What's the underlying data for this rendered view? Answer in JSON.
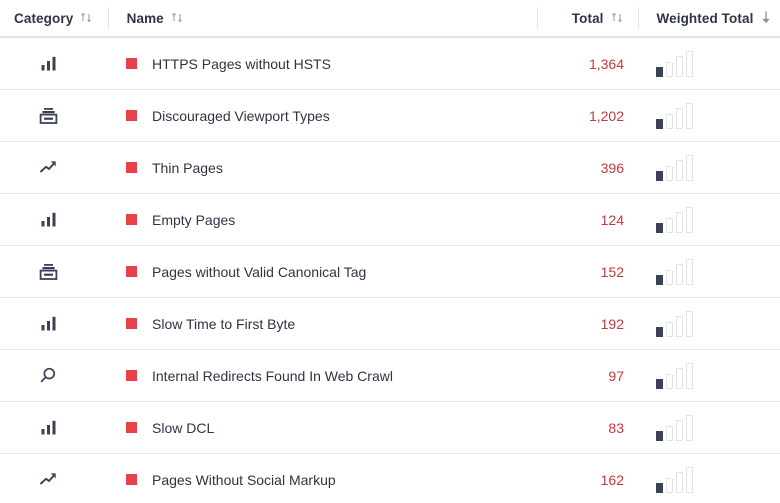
{
  "table": {
    "columns": [
      {
        "key": "category",
        "label": "Category",
        "sort_icon": "sort-updown-icon",
        "sorted": false
      },
      {
        "key": "name",
        "label": "Name",
        "sort_icon": "sort-updown-icon",
        "sorted": false
      },
      {
        "key": "total",
        "label": "Total",
        "sort_icon": "sort-updown-icon",
        "sorted": false
      },
      {
        "key": "weighted_total",
        "label": "Weighted Total",
        "sort_icon": "sort-desc-icon",
        "sorted": true
      }
    ],
    "rows": [
      {
        "category_icon": "bar-chart-icon",
        "marker": "red-square-marker",
        "name": "HTTPS Pages without HSTS",
        "total": "1,364",
        "weighted_chart": {
          "type": "bar",
          "values": [
            8,
            14,
            20,
            25
          ],
          "highlight_index": 0
        }
      },
      {
        "category_icon": "server-stack-icon",
        "marker": "red-square-marker",
        "name": "Discouraged Viewport Types",
        "total": "1,202",
        "weighted_chart": {
          "type": "bar",
          "values": [
            8,
            14,
            20,
            25
          ],
          "highlight_index": 0
        }
      },
      {
        "category_icon": "trending-up-icon",
        "marker": "red-square-marker",
        "name": "Thin Pages",
        "total": "396",
        "weighted_chart": {
          "type": "bar",
          "values": [
            8,
            14,
            20,
            25
          ],
          "highlight_index": 0
        }
      },
      {
        "category_icon": "bar-chart-icon",
        "marker": "red-square-marker",
        "name": "Empty Pages",
        "total": "124",
        "weighted_chart": {
          "type": "bar",
          "values": [
            8,
            14,
            20,
            25
          ],
          "highlight_index": 0
        }
      },
      {
        "category_icon": "server-stack-icon",
        "marker": "red-square-marker",
        "name": "Pages without Valid Canonical Tag",
        "total": "152",
        "weighted_chart": {
          "type": "bar",
          "values": [
            8,
            14,
            20,
            25
          ],
          "highlight_index": 0
        }
      },
      {
        "category_icon": "bar-chart-icon",
        "marker": "red-square-marker",
        "name": "Slow Time to First Byte",
        "total": "192",
        "weighted_chart": {
          "type": "bar",
          "values": [
            8,
            14,
            20,
            25
          ],
          "highlight_index": 0
        }
      },
      {
        "category_icon": "search-icon",
        "marker": "red-square-marker",
        "name": "Internal Redirects Found In Web Crawl",
        "total": "97",
        "weighted_chart": {
          "type": "bar",
          "values": [
            8,
            14,
            20,
            25
          ],
          "highlight_index": 0
        }
      },
      {
        "category_icon": "bar-chart-icon",
        "marker": "red-square-marker",
        "name": "Slow DCL",
        "total": "83",
        "weighted_chart": {
          "type": "bar",
          "values": [
            8,
            14,
            20,
            25
          ],
          "highlight_index": 0
        }
      },
      {
        "category_icon": "trending-up-icon",
        "marker": "red-square-marker",
        "name": "Pages Without Social Markup",
        "total": "162",
        "weighted_chart": {
          "type": "bar",
          "values": [
            8,
            14,
            20,
            25
          ],
          "highlight_index": 0
        }
      }
    ]
  },
  "colors": {
    "marker_red": "#e8414a",
    "total_text": "#c4393f",
    "icon_dark": "#3c4256",
    "header_text": "#2f3444",
    "row_border": "#e9eaec",
    "header_border": "#e2e3e6",
    "minibar_empty": "#e3e4e8"
  }
}
